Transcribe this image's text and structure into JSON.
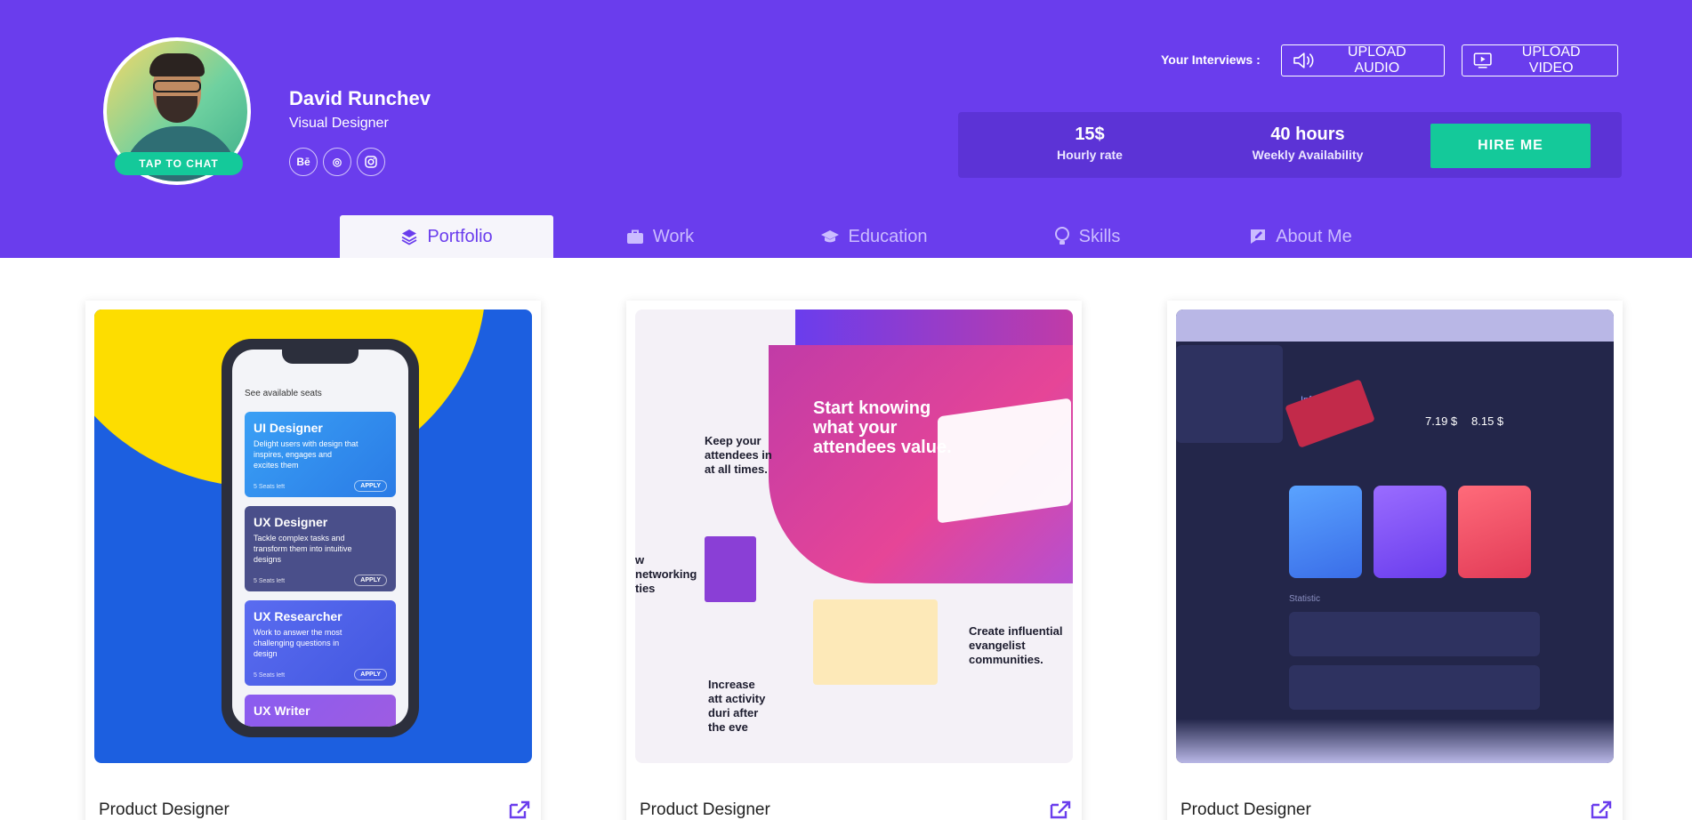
{
  "profile": {
    "name": "David Runchev",
    "role": "Visual Designer",
    "chat_label": "TAP TO CHAT",
    "socials": [
      {
        "icon": "behance-icon",
        "glyph": "Bē"
      },
      {
        "icon": "dribbble-icon",
        "glyph": "◎"
      },
      {
        "icon": "instagram-icon",
        "glyph": "◻"
      }
    ]
  },
  "interviews": {
    "label": "Your Interviews :",
    "upload_audio": "UPLOAD AUDIO",
    "upload_video": "UPLOAD VIDEO"
  },
  "rates": {
    "hourly_value": "15$",
    "hourly_label": "Hourly rate",
    "weekly_value": "40 hours",
    "weekly_label": "Weekly Availability",
    "hire_label": "HIRE ME"
  },
  "tabs": [
    {
      "label": "Portfolio",
      "icon": "layers-icon",
      "active": true
    },
    {
      "label": "Work",
      "icon": "briefcase-icon",
      "active": false
    },
    {
      "label": "Education",
      "icon": "graduation-cap-icon",
      "active": false
    },
    {
      "label": "Skills",
      "icon": "lightbulb-icon",
      "active": false
    },
    {
      "label": "About Me",
      "icon": "edit-icon",
      "active": false
    }
  ],
  "portfolio": [
    {
      "title": "Product Designer"
    },
    {
      "title": "Product Designer"
    },
    {
      "title": "Product Designer"
    }
  ],
  "mock1": {
    "seats": "See available seats",
    "jobs": [
      {
        "title": "UI Designer",
        "desc": "Delight users with design that inspires, engages and excites them",
        "foot": "5 Seats left",
        "apply": "APPLY"
      },
      {
        "title": "UX Designer",
        "desc": "Tackle complex tasks and transform them into intuitive designs",
        "foot": "5 Seats left",
        "apply": "APPLY"
      },
      {
        "title": "UX Researcher",
        "desc": "Work to answer the most challenging questions in design",
        "foot": "5 Seats left",
        "apply": "APPLY"
      },
      {
        "title": "UX Writer"
      }
    ]
  },
  "mock2": {
    "headline": "Start knowing what your attendees value.",
    "keep": "Keep your attendees in at all times.",
    "influential": "Create influential evangelist communities.",
    "increase": "Increase att activity duri after the eve",
    "networking": "w networking ties"
  },
  "mock3": {
    "price_from": "7.19 $",
    "price_to": "8.15 $",
    "info": "Information",
    "stat": "Statistic"
  },
  "colors": {
    "brand": "#6a3ded",
    "accent": "#14c99a"
  }
}
